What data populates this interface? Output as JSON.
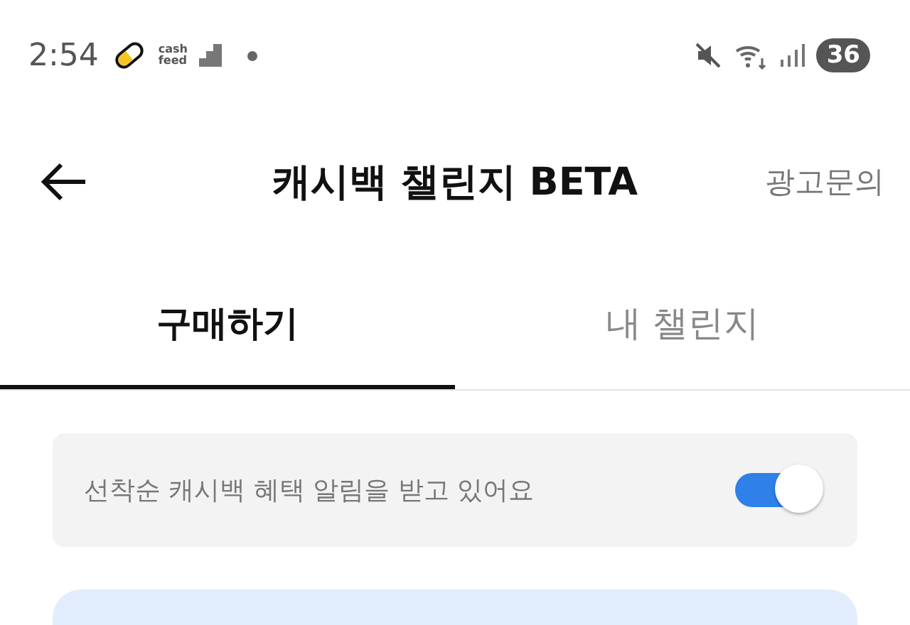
{
  "status_bar": {
    "time": "2:54",
    "app_logo": {
      "line_1": "cash",
      "line_2": "feed"
    },
    "battery": "36"
  },
  "header": {
    "title": "캐시백 챌린지 BETA",
    "action": "광고문의"
  },
  "tabs": [
    {
      "label": "구매하기",
      "selected": true
    },
    {
      "label": "내 챌린지",
      "selected": false
    }
  ],
  "notice": {
    "text": "선착순 캐시백 혜택 알림을 받고 있어요",
    "on": true
  }
}
